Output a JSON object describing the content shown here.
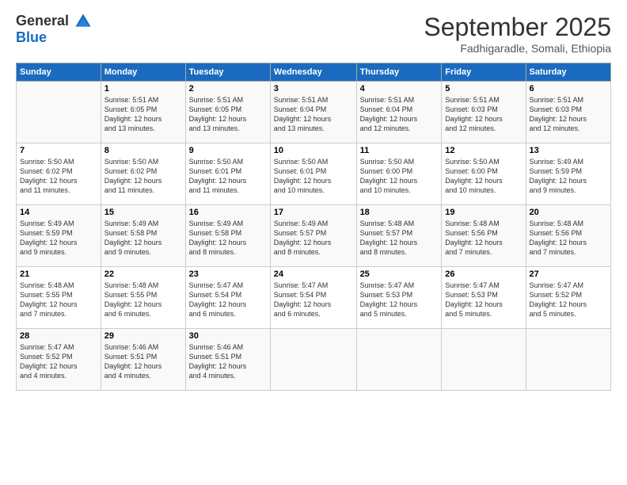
{
  "logo": {
    "general": "General",
    "blue": "Blue"
  },
  "header": {
    "title": "September 2025",
    "subtitle": "Fadhigaradle, Somali, Ethiopia"
  },
  "days_of_week": [
    "Sunday",
    "Monday",
    "Tuesday",
    "Wednesday",
    "Thursday",
    "Friday",
    "Saturday"
  ],
  "weeks": [
    [
      {
        "day": "",
        "info": ""
      },
      {
        "day": "1",
        "info": "Sunrise: 5:51 AM\nSunset: 6:05 PM\nDaylight: 12 hours\nand 13 minutes."
      },
      {
        "day": "2",
        "info": "Sunrise: 5:51 AM\nSunset: 6:05 PM\nDaylight: 12 hours\nand 13 minutes."
      },
      {
        "day": "3",
        "info": "Sunrise: 5:51 AM\nSunset: 6:04 PM\nDaylight: 12 hours\nand 13 minutes."
      },
      {
        "day": "4",
        "info": "Sunrise: 5:51 AM\nSunset: 6:04 PM\nDaylight: 12 hours\nand 12 minutes."
      },
      {
        "day": "5",
        "info": "Sunrise: 5:51 AM\nSunset: 6:03 PM\nDaylight: 12 hours\nand 12 minutes."
      },
      {
        "day": "6",
        "info": "Sunrise: 5:51 AM\nSunset: 6:03 PM\nDaylight: 12 hours\nand 12 minutes."
      }
    ],
    [
      {
        "day": "7",
        "info": "Sunrise: 5:50 AM\nSunset: 6:02 PM\nDaylight: 12 hours\nand 11 minutes."
      },
      {
        "day": "8",
        "info": "Sunrise: 5:50 AM\nSunset: 6:02 PM\nDaylight: 12 hours\nand 11 minutes."
      },
      {
        "day": "9",
        "info": "Sunrise: 5:50 AM\nSunset: 6:01 PM\nDaylight: 12 hours\nand 11 minutes."
      },
      {
        "day": "10",
        "info": "Sunrise: 5:50 AM\nSunset: 6:01 PM\nDaylight: 12 hours\nand 10 minutes."
      },
      {
        "day": "11",
        "info": "Sunrise: 5:50 AM\nSunset: 6:00 PM\nDaylight: 12 hours\nand 10 minutes."
      },
      {
        "day": "12",
        "info": "Sunrise: 5:50 AM\nSunset: 6:00 PM\nDaylight: 12 hours\nand 10 minutes."
      },
      {
        "day": "13",
        "info": "Sunrise: 5:49 AM\nSunset: 5:59 PM\nDaylight: 12 hours\nand 9 minutes."
      }
    ],
    [
      {
        "day": "14",
        "info": "Sunrise: 5:49 AM\nSunset: 5:59 PM\nDaylight: 12 hours\nand 9 minutes."
      },
      {
        "day": "15",
        "info": "Sunrise: 5:49 AM\nSunset: 5:58 PM\nDaylight: 12 hours\nand 9 minutes."
      },
      {
        "day": "16",
        "info": "Sunrise: 5:49 AM\nSunset: 5:58 PM\nDaylight: 12 hours\nand 8 minutes."
      },
      {
        "day": "17",
        "info": "Sunrise: 5:49 AM\nSunset: 5:57 PM\nDaylight: 12 hours\nand 8 minutes."
      },
      {
        "day": "18",
        "info": "Sunrise: 5:48 AM\nSunset: 5:57 PM\nDaylight: 12 hours\nand 8 minutes."
      },
      {
        "day": "19",
        "info": "Sunrise: 5:48 AM\nSunset: 5:56 PM\nDaylight: 12 hours\nand 7 minutes."
      },
      {
        "day": "20",
        "info": "Sunrise: 5:48 AM\nSunset: 5:56 PM\nDaylight: 12 hours\nand 7 minutes."
      }
    ],
    [
      {
        "day": "21",
        "info": "Sunrise: 5:48 AM\nSunset: 5:55 PM\nDaylight: 12 hours\nand 7 minutes."
      },
      {
        "day": "22",
        "info": "Sunrise: 5:48 AM\nSunset: 5:55 PM\nDaylight: 12 hours\nand 6 minutes."
      },
      {
        "day": "23",
        "info": "Sunrise: 5:47 AM\nSunset: 5:54 PM\nDaylight: 12 hours\nand 6 minutes."
      },
      {
        "day": "24",
        "info": "Sunrise: 5:47 AM\nSunset: 5:54 PM\nDaylight: 12 hours\nand 6 minutes."
      },
      {
        "day": "25",
        "info": "Sunrise: 5:47 AM\nSunset: 5:53 PM\nDaylight: 12 hours\nand 5 minutes."
      },
      {
        "day": "26",
        "info": "Sunrise: 5:47 AM\nSunset: 5:53 PM\nDaylight: 12 hours\nand 5 minutes."
      },
      {
        "day": "27",
        "info": "Sunrise: 5:47 AM\nSunset: 5:52 PM\nDaylight: 12 hours\nand 5 minutes."
      }
    ],
    [
      {
        "day": "28",
        "info": "Sunrise: 5:47 AM\nSunset: 5:52 PM\nDaylight: 12 hours\nand 4 minutes."
      },
      {
        "day": "29",
        "info": "Sunrise: 5:46 AM\nSunset: 5:51 PM\nDaylight: 12 hours\nand 4 minutes."
      },
      {
        "day": "30",
        "info": "Sunrise: 5:46 AM\nSunset: 5:51 PM\nDaylight: 12 hours\nand 4 minutes."
      },
      {
        "day": "",
        "info": ""
      },
      {
        "day": "",
        "info": ""
      },
      {
        "day": "",
        "info": ""
      },
      {
        "day": "",
        "info": ""
      }
    ]
  ]
}
